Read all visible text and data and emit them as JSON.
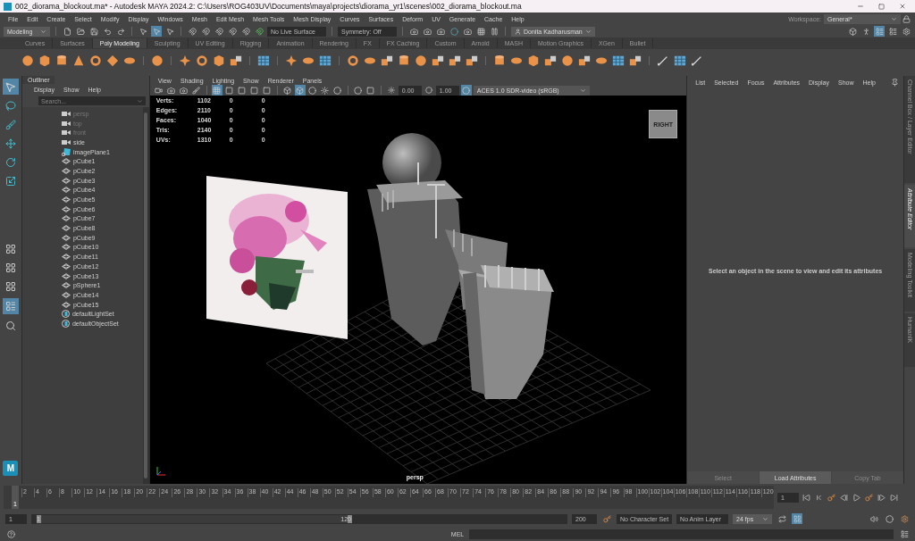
{
  "window": {
    "title": "002_diorama_blockout.ma* - Autodesk MAYA 2024.2: C:\\Users\\ROG403UV\\Documents\\maya\\projects\\diorama_yr1\\scenes\\002_diorama_blockout.ma"
  },
  "menu": [
    "File",
    "Edit",
    "Create",
    "Select",
    "Modify",
    "Display",
    "Windows",
    "Mesh",
    "Edit Mesh",
    "Mesh Tools",
    "Mesh Display",
    "Curves",
    "Surfaces",
    "Deform",
    "UV",
    "Generate",
    "Cache",
    "Help"
  ],
  "workspace": {
    "label": "Workspace:",
    "value": "General*"
  },
  "status_line": {
    "menu_set": "Modeling",
    "live_surface": "No Live Surface",
    "symmetry": "Symmetry: Off",
    "user": "Donita Kadharusman"
  },
  "shelf_tabs": [
    {
      "label": "Curves",
      "selected": false
    },
    {
      "label": "Surfaces",
      "selected": false
    },
    {
      "label": "Poly Modeling",
      "selected": true
    },
    {
      "label": "Sculpting",
      "selected": false
    },
    {
      "label": "UV Editing",
      "selected": false
    },
    {
      "label": "Rigging",
      "selected": false
    },
    {
      "label": "Animation",
      "selected": false
    },
    {
      "label": "Rendering",
      "selected": false
    },
    {
      "label": "FX",
      "selected": false
    },
    {
      "label": "FX Caching",
      "selected": false
    },
    {
      "label": "Custom",
      "selected": false
    },
    {
      "label": "Arnold",
      "selected": false
    },
    {
      "label": "MASH",
      "selected": false
    },
    {
      "label": "Motion Graphics",
      "selected": false
    },
    {
      "label": "XGen",
      "selected": false
    },
    {
      "label": "Bullet",
      "selected": false
    }
  ],
  "outliner": {
    "title": "Outliner",
    "menu": [
      "Display",
      "Show",
      "Help"
    ],
    "search_placeholder": "Search...",
    "items": [
      {
        "name": "persp",
        "kind": "camera",
        "dimmed": true
      },
      {
        "name": "top",
        "kind": "camera",
        "dimmed": true
      },
      {
        "name": "front",
        "kind": "camera",
        "dimmed": true
      },
      {
        "name": "side",
        "kind": "camera",
        "dimmed": false
      },
      {
        "name": "imagePlane1",
        "kind": "image_plane",
        "dimmed": false
      },
      {
        "name": "pCube1",
        "kind": "mesh",
        "dimmed": false
      },
      {
        "name": "pCube2",
        "kind": "mesh",
        "dimmed": false
      },
      {
        "name": "pCube3",
        "kind": "mesh",
        "dimmed": false
      },
      {
        "name": "pCube4",
        "kind": "mesh",
        "dimmed": false
      },
      {
        "name": "pCube5",
        "kind": "mesh",
        "dimmed": false
      },
      {
        "name": "pCube6",
        "kind": "mesh",
        "dimmed": false
      },
      {
        "name": "pCube7",
        "kind": "mesh",
        "dimmed": false
      },
      {
        "name": "pCube8",
        "kind": "mesh",
        "dimmed": false
      },
      {
        "name": "pCube9",
        "kind": "mesh",
        "dimmed": false
      },
      {
        "name": "pCube10",
        "kind": "mesh",
        "dimmed": false
      },
      {
        "name": "pCube11",
        "kind": "mesh",
        "dimmed": false
      },
      {
        "name": "pCube12",
        "kind": "mesh",
        "dimmed": false
      },
      {
        "name": "pCube13",
        "kind": "mesh",
        "dimmed": false
      },
      {
        "name": "pSphere1",
        "kind": "mesh",
        "dimmed": false
      },
      {
        "name": "pCube14",
        "kind": "mesh",
        "dimmed": false
      },
      {
        "name": "pCube15",
        "kind": "mesh",
        "dimmed": false
      },
      {
        "name": "defaultLightSet",
        "kind": "set",
        "dimmed": false
      },
      {
        "name": "defaultObjectSet",
        "kind": "set",
        "dimmed": false
      }
    ]
  },
  "viewport": {
    "menu": [
      "View",
      "Shading",
      "Lighting",
      "Show",
      "Renderer",
      "Panels"
    ],
    "hud": [
      {
        "label": "Verts:",
        "values": [
          "1102",
          "0",
          "0"
        ]
      },
      {
        "label": "Edges:",
        "values": [
          "2110",
          "0",
          "0"
        ]
      },
      {
        "label": "Faces:",
        "values": [
          "1040",
          "0",
          "0"
        ]
      },
      {
        "label": "Tris:",
        "values": [
          "2140",
          "0",
          "0"
        ]
      },
      {
        "label": "UVs:",
        "values": [
          "1310",
          "0",
          "0"
        ]
      }
    ],
    "exposure": "0.00",
    "gamma": "1.00",
    "color_space": "ACES 1.0 SDR-video (sRGB)",
    "view_cube": "RIGHT",
    "camera": "persp",
    "image_plane": {
      "kind": "picture"
    }
  },
  "attribute_editor": {
    "menu": [
      "List",
      "Selected",
      "Focus",
      "Attributes",
      "Display",
      "Show",
      "Help"
    ],
    "message": "Select an object in the scene to view and edit its attributes",
    "buttons": [
      "Select",
      "Load Attributes",
      "Copy Tab"
    ]
  },
  "side_tabs": [
    {
      "label": "Channel Box / Layer Editor",
      "selected": false
    },
    {
      "label": "Attribute Editor",
      "selected": true
    },
    {
      "label": "Modeling Toolkit",
      "selected": false
    },
    {
      "label": "HumanIK",
      "selected": false
    }
  ],
  "logo": "M",
  "time_slider": {
    "current": "1",
    "level": 0,
    "ticks": [
      "2",
      "4",
      "6",
      "8",
      "10",
      "12",
      "14",
      "16",
      "18",
      "20",
      "22",
      "24",
      "26",
      "28",
      "30",
      "32",
      "34",
      "36",
      "38",
      "40",
      "42",
      "44",
      "46",
      "48",
      "50",
      "52",
      "54",
      "56",
      "58",
      "60",
      "62",
      "64",
      "66",
      "68",
      "70",
      "72",
      "74",
      "76",
      "78",
      "80",
      "82",
      "84",
      "86",
      "88",
      "90",
      "92",
      "94",
      "96",
      "98",
      "100",
      "102",
      "104",
      "106",
      "108",
      "110",
      "112",
      "114",
      "116",
      "118",
      "120"
    ],
    "frame_field": "1"
  },
  "range_slider": {
    "level": 0.6,
    "start": "1",
    "range_start": "1",
    "range_end": "120",
    "end": "200",
    "character_set": "No Character Set",
    "anim_layer": "No Anim Layer",
    "fps": "24 fps"
  },
  "command_line": {
    "language": "MEL"
  }
}
